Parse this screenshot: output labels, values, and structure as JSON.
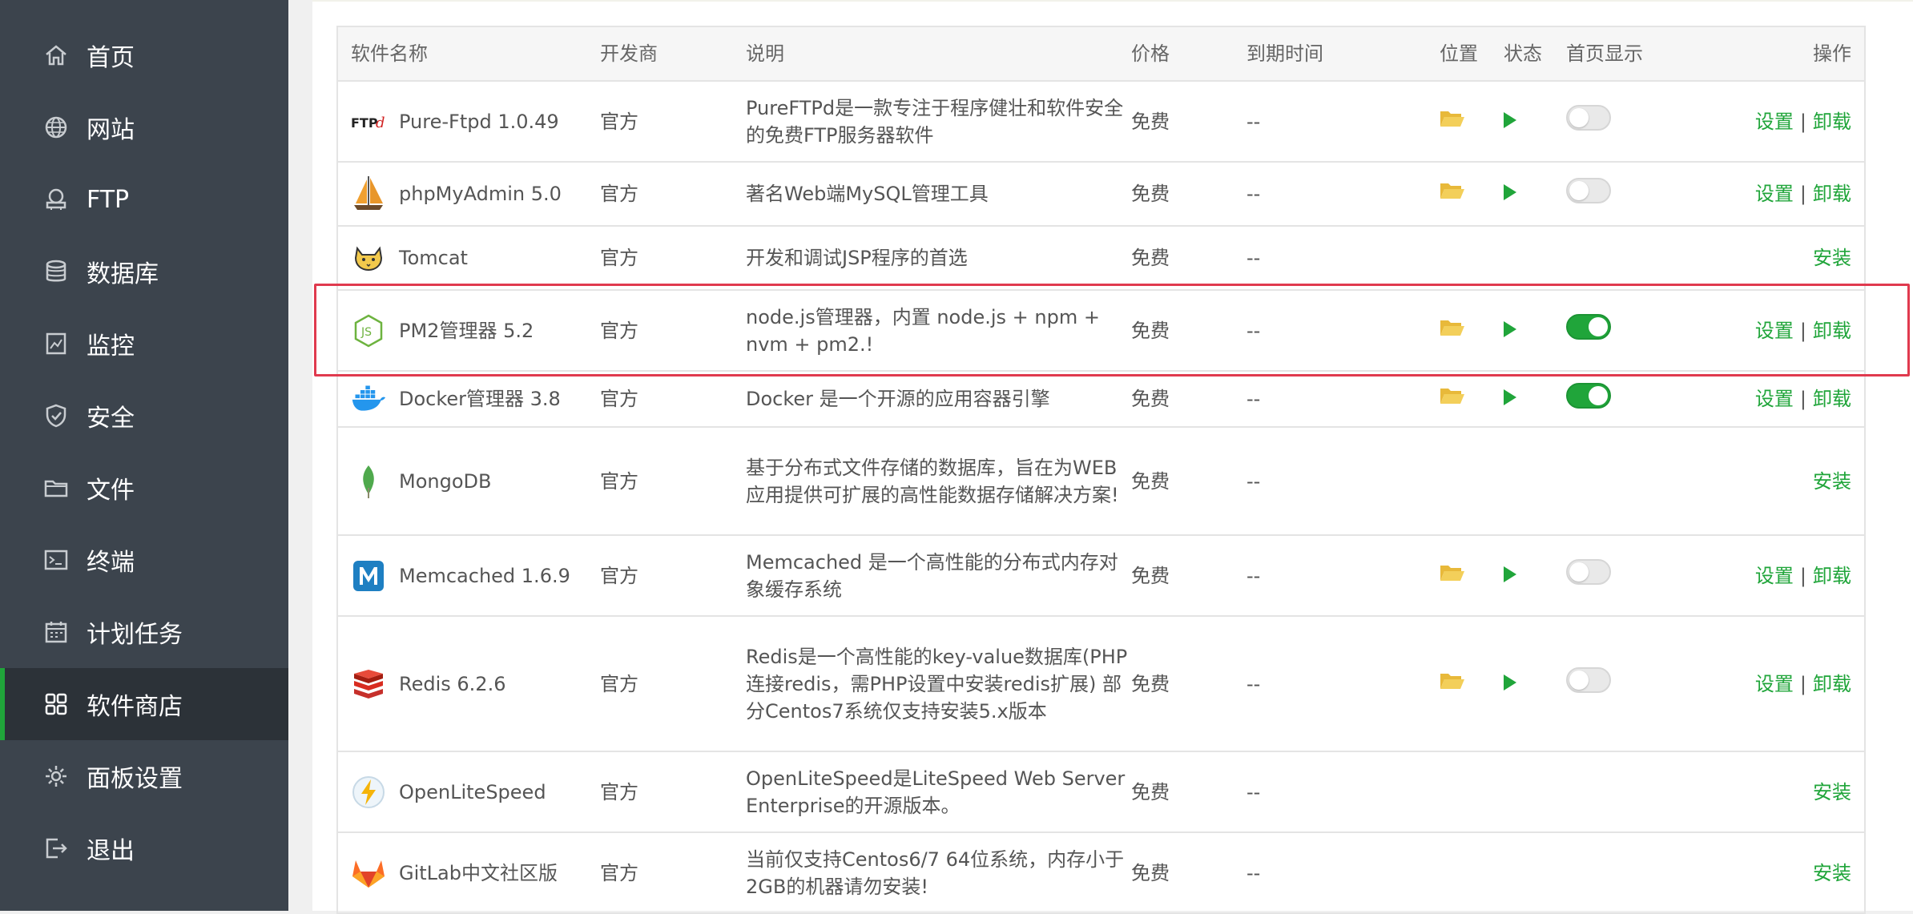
{
  "sidebar": {
    "items": [
      {
        "label": "首页",
        "icon": "home-icon"
      },
      {
        "label": "网站",
        "icon": "globe-icon"
      },
      {
        "label": "FTP",
        "icon": "ftp-icon"
      },
      {
        "label": "数据库",
        "icon": "database-icon"
      },
      {
        "label": "监控",
        "icon": "monitor-icon"
      },
      {
        "label": "安全",
        "icon": "shield-icon"
      },
      {
        "label": "文件",
        "icon": "folder-icon"
      },
      {
        "label": "终端",
        "icon": "terminal-icon"
      },
      {
        "label": "计划任务",
        "icon": "calendar-icon"
      },
      {
        "label": "软件商店",
        "icon": "grid-icon",
        "active": true
      },
      {
        "label": "面板设置",
        "icon": "gear-icon"
      },
      {
        "label": "退出",
        "icon": "logout-icon"
      }
    ]
  },
  "table": {
    "headers": {
      "name": "软件名称",
      "developer": "开发商",
      "description": "说明",
      "price": "价格",
      "expire": "到期时间",
      "location": "位置",
      "status": "状态",
      "homepage": "首页显示",
      "actions": "操作"
    },
    "rows": [
      {
        "name": "Pure-Ftpd 1.0.49",
        "developer": "官方",
        "desc": "PureFTPd是一款专注于程序健壮和软件安全的免费FTP服务器软件",
        "price": "免费",
        "expire": "--",
        "installed": true,
        "toggle": "off",
        "logo": "pureftpd-logo",
        "settings": "设置",
        "sep": "|",
        "uninstall": "卸载"
      },
      {
        "name": "phpMyAdmin 5.0",
        "developer": "官方",
        "desc": "著名Web端MySQL管理工具",
        "price": "免费",
        "expire": "--",
        "installed": true,
        "toggle": "off",
        "logo": "phpmyadmin-logo",
        "settings": "设置",
        "sep": "|",
        "uninstall": "卸载"
      },
      {
        "name": "Tomcat",
        "developer": "官方",
        "desc": "开发和调试JSP程序的首选",
        "price": "免费",
        "expire": "--",
        "installed": false,
        "logo": "tomcat-logo",
        "install": "安装"
      },
      {
        "name": "PM2管理器 5.2",
        "developer": "官方",
        "desc": "node.js管理器，内置 node.js + npm + nvm + pm2.!",
        "price": "免费",
        "expire": "--",
        "installed": true,
        "toggle": "on",
        "logo": "nodejs-logo",
        "settings": "设置",
        "sep": "|",
        "uninstall": "卸载"
      },
      {
        "name": "Docker管理器 3.8",
        "developer": "官方",
        "desc": "Docker 是一个开源的应用容器引擎",
        "price": "免费",
        "expire": "--",
        "installed": true,
        "toggle": "on",
        "logo": "docker-logo",
        "settings": "设置",
        "sep": "|",
        "uninstall": "卸载"
      },
      {
        "name": "MongoDB",
        "developer": "官方",
        "desc": "基于分布式文件存储的数据库，旨在为WEB应用提供可扩展的高性能数据存储解决方案!",
        "price": "免费",
        "expire": "--",
        "installed": false,
        "logo": "mongodb-logo",
        "install": "安装"
      },
      {
        "name": "Memcached 1.6.9",
        "developer": "官方",
        "desc": "Memcached 是一个高性能的分布式内存对象缓存系统",
        "price": "免费",
        "expire": "--",
        "installed": true,
        "toggle": "off",
        "logo": "memcached-logo",
        "settings": "设置",
        "sep": "|",
        "uninstall": "卸载"
      },
      {
        "name": "Redis 6.2.6",
        "developer": "官方",
        "desc": "Redis是一个高性能的key-value数据库(PHP连接redis，需PHP设置中安装redis扩展) 部分Centos7系统仅支持安装5.x版本",
        "price": "免费",
        "expire": "--",
        "installed": true,
        "toggle": "off",
        "logo": "redis-logo",
        "settings": "设置",
        "sep": "|",
        "uninstall": "卸载"
      },
      {
        "name": "OpenLiteSpeed",
        "developer": "官方",
        "desc": "OpenLiteSpeed是LiteSpeed Web Server Enterprise的开源版本。",
        "price": "免费",
        "expire": "--",
        "installed": false,
        "logo": "openlitespeed-logo",
        "install": "安装"
      },
      {
        "name": "GitLab中文社区版",
        "developer": "官方",
        "desc": "当前仅支持Centos6/7 64位系统，内存小于2GB的机器请勿安装!",
        "price": "免费",
        "expire": "--",
        "installed": false,
        "logo": "gitlab-logo",
        "install": "安装"
      }
    ]
  },
  "colors": {
    "accent": "#20a53a",
    "highlight": "#e03a4e",
    "folder": "#f0c44c",
    "sidebar": "#3c444d"
  }
}
